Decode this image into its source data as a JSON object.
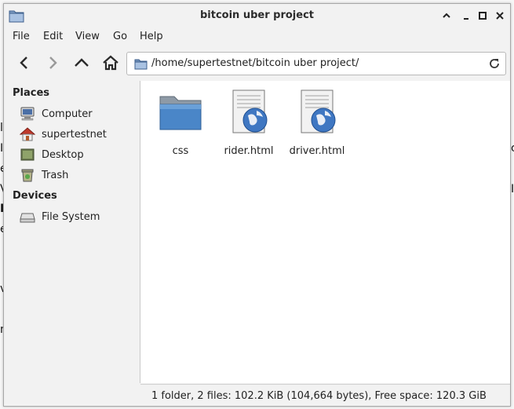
{
  "window": {
    "title": "bitcoin uber project"
  },
  "menu": [
    "File",
    "Edit",
    "View",
    "Go",
    "Help"
  ],
  "location": {
    "path": "/home/supertestnet/bitcoin uber project/"
  },
  "sidebar": {
    "places_heading": "Places",
    "places": [
      {
        "label": "Computer",
        "icon": "computer-icon"
      },
      {
        "label": "supertestnet",
        "icon": "home-icon"
      },
      {
        "label": "Desktop",
        "icon": "desktop-icon"
      },
      {
        "label": "Trash",
        "icon": "trash-icon"
      }
    ],
    "devices_heading": "Devices",
    "devices": [
      {
        "label": "File System",
        "icon": "drive-icon"
      }
    ]
  },
  "files": [
    {
      "name": "css",
      "type": "folder"
    },
    {
      "name": "rider.html",
      "type": "html"
    },
    {
      "name": "driver.html",
      "type": "html"
    }
  ],
  "status": "1 folder, 2 files: 102.2 KiB (104,664 bytes), Free space: 120.3 GiB",
  "colors": {
    "folder_blue": "#4a86c8",
    "home_red": "#c0392b"
  }
}
